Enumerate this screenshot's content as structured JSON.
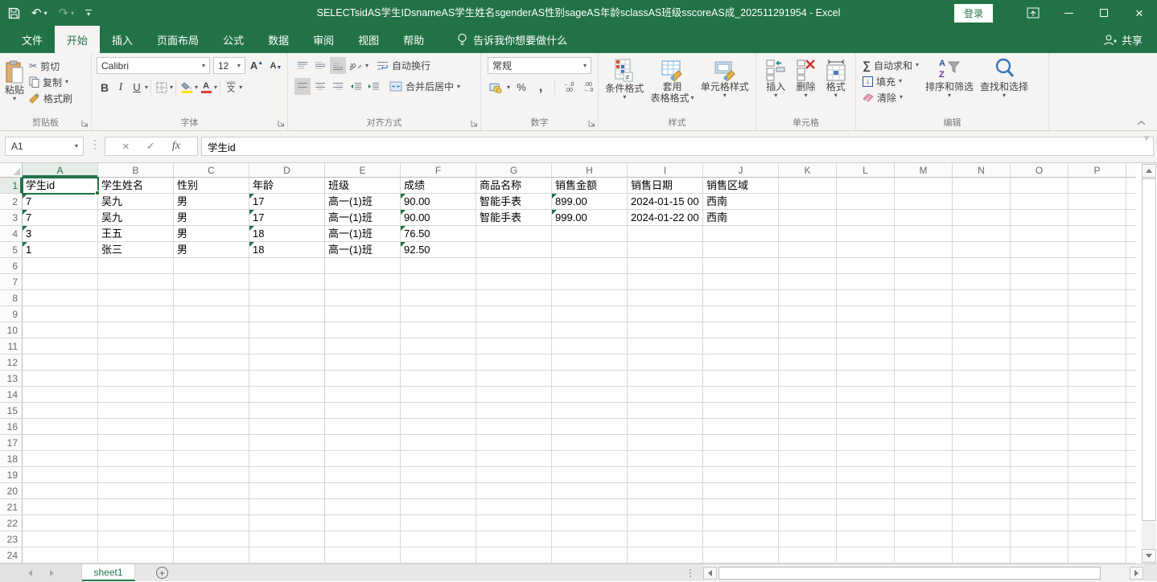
{
  "window": {
    "title": "SELECTsidAS学生IDsnameAS学生姓名sgenderAS性别sageAS年龄sclassAS班级sscoreAS成_202511291954 - Excel",
    "login": "登录"
  },
  "tabs": {
    "items": [
      {
        "label": "文件",
        "active": false
      },
      {
        "label": "开始",
        "active": true
      },
      {
        "label": "插入",
        "active": false
      },
      {
        "label": "页面布局",
        "active": false
      },
      {
        "label": "公式",
        "active": false
      },
      {
        "label": "数据",
        "active": false
      },
      {
        "label": "审阅",
        "active": false
      },
      {
        "label": "视图",
        "active": false
      },
      {
        "label": "帮助",
        "active": false
      }
    ],
    "tell_me": "告诉我你想要做什么",
    "share": "共享"
  },
  "ribbon": {
    "clipboard": {
      "group": "剪贴板",
      "paste": "粘贴",
      "cut": "剪切",
      "copy": "复制",
      "format_painter": "格式刷"
    },
    "font": {
      "group": "字体",
      "name": "Calibri",
      "size": "12",
      "bold": "B",
      "italic": "I",
      "underline": "U",
      "phonetic": "文",
      "phonetic_pinyin": "wén"
    },
    "alignment": {
      "group": "对齐方式",
      "wrap": "自动换行",
      "merge": "合并后居中"
    },
    "number": {
      "group": "数字",
      "format": "常规",
      "percent": "%",
      "comma": ","
    },
    "styles": {
      "group": "样式",
      "conditional": "条件格式",
      "format_table_line1": "套用",
      "format_table_line2": "表格格式",
      "cell_styles": "单元格样式"
    },
    "cells": {
      "group": "单元格",
      "insert": "插入",
      "del": "删除",
      "format": "格式"
    },
    "editing": {
      "group": "编辑",
      "autosum": "自动求和",
      "fill": "填充",
      "clear": "清除",
      "sort": "排序和筛选",
      "find": "查找和选择"
    }
  },
  "formula_bar": {
    "name_box": "A1",
    "value": "学生id"
  },
  "sheet": {
    "columns": [
      "A",
      "B",
      "C",
      "D",
      "E",
      "F",
      "G",
      "H",
      "I",
      "J",
      "K",
      "L",
      "M",
      "N",
      "O",
      "P"
    ],
    "row_count": 24,
    "rows": [
      [
        "学生id",
        "学生姓名",
        "性别",
        "年龄",
        "班级",
        "成绩",
        "商品名称",
        "销售金额",
        "销售日期",
        "销售区域"
      ],
      [
        "7",
        "吴九",
        "男",
        "17",
        "高一(1)班",
        "90.00",
        "智能手表",
        "899.00",
        "2024-01-15 00",
        "西南"
      ],
      [
        "7",
        "吴九",
        "男",
        "17",
        "高一(1)班",
        "90.00",
        "智能手表",
        "999.00",
        "2024-01-22 00",
        "西南"
      ],
      [
        "3",
        "王五",
        "男",
        "18",
        "高一(1)班",
        "76.50",
        "",
        "",
        "",
        ""
      ],
      [
        "1",
        "张三",
        "男",
        "18",
        "高一(1)班",
        "92.50",
        "",
        "",
        "",
        ""
      ]
    ],
    "error_flags": [
      "A2",
      "A3",
      "A4",
      "A5",
      "D2",
      "D3",
      "D4",
      "D5",
      "F2",
      "F3",
      "F4",
      "F5",
      "H2",
      "H3"
    ],
    "active_cell": "A1"
  },
  "sheet_bar": {
    "tab": "sheet1"
  },
  "colors": {
    "accent": "#217346",
    "error_flag": "#1d7044",
    "header_selected_bg": "#e4ece7"
  }
}
